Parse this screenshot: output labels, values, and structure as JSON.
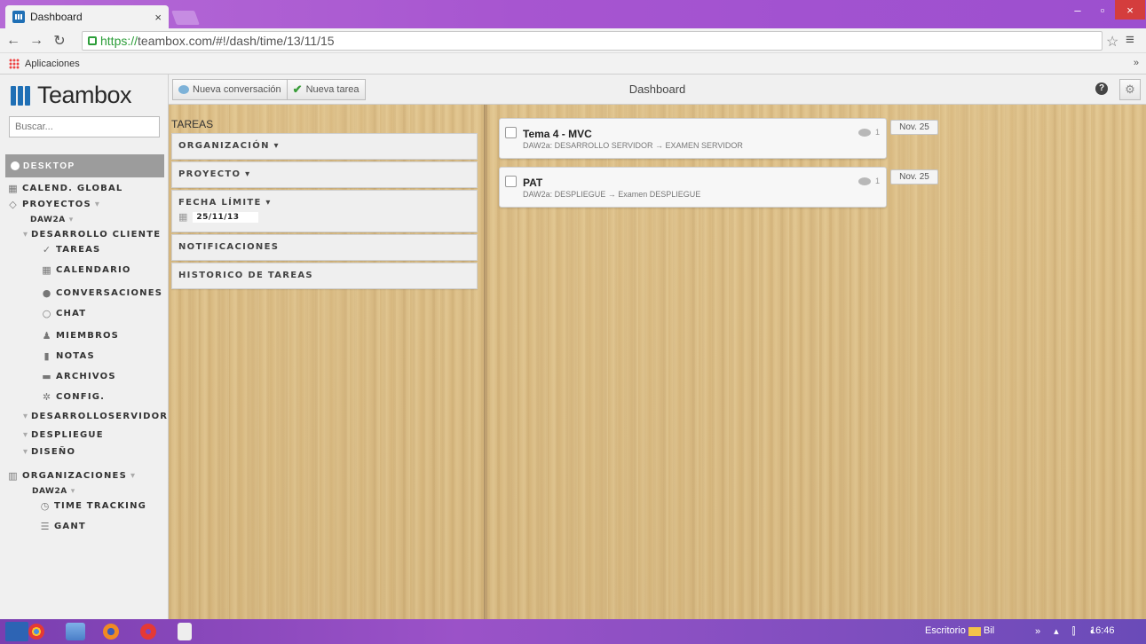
{
  "browser": {
    "tab_title": "Dashboard",
    "tab_close": "×",
    "url_scheme": "https://",
    "url_rest": "teambox.com/#!/dash/time/13/11/15",
    "bookmarks_label": "Aplicaciones",
    "bookmarks_more": "»",
    "window_min": "–",
    "window_max": "▫",
    "window_close": "×"
  },
  "sidebar": {
    "logo": "Teambox",
    "search_placeholder": "Buscar...",
    "desktop": "DESKTOP",
    "global_calendar": "CALEND. GLOBAL",
    "projects": "PROYECTOS",
    "org_daw2a": "DAW2A",
    "project_client": "DESARROLLO CLIENTE",
    "items": {
      "tasks": "TAREAS",
      "calendar": "CALENDARIO",
      "conversations": "CONVERSACIONES",
      "chat": "CHAT",
      "members": "MIEMBROS",
      "notes": "NOTAS",
      "files": "ARCHIVOS",
      "config": "CONFIG."
    },
    "project_server": "DESARROLLOSERVIDOR",
    "project_deploy": "DESPLIEGUE",
    "project_design": "DISEÑO",
    "organizations": "ORGANIZACIONES",
    "org_daw2a_2": "DAW2A",
    "time_tracking": "TIME TRACKING",
    "gant": "GANT"
  },
  "header": {
    "new_conversation": "Nueva conversación",
    "new_task": "Nueva tarea",
    "title": "Dashboard",
    "help": "?",
    "settings": "⚙"
  },
  "filters": {
    "title": "TAREAS",
    "organization": "ORGANIZACIÓN ▾",
    "project": "PROYECTO ▾",
    "due_date": "FECHA LÍMITE ▾",
    "due_date_value": "25/11/13",
    "notifications": "NOTIFICACIONES",
    "history": "HISTORICO DE TAREAS"
  },
  "tasks": [
    {
      "name": "Tema 4 - MVC",
      "path": "DAW2a: DESARROLLO SERVIDOR → EXAMEN SERVIDOR",
      "comments": "1",
      "due": "Nov. 25"
    },
    {
      "name": "PAT",
      "path": "DAW2a: DESPLIEGUE → Examen DESPLIEGUE",
      "comments": "1",
      "due": "Nov. 25"
    }
  ],
  "taskbar": {
    "desktop_label": "Escritorio",
    "bil_label": "Bil",
    "tray": "» ▴ ⫿ ◖",
    "clock": "16:46"
  }
}
